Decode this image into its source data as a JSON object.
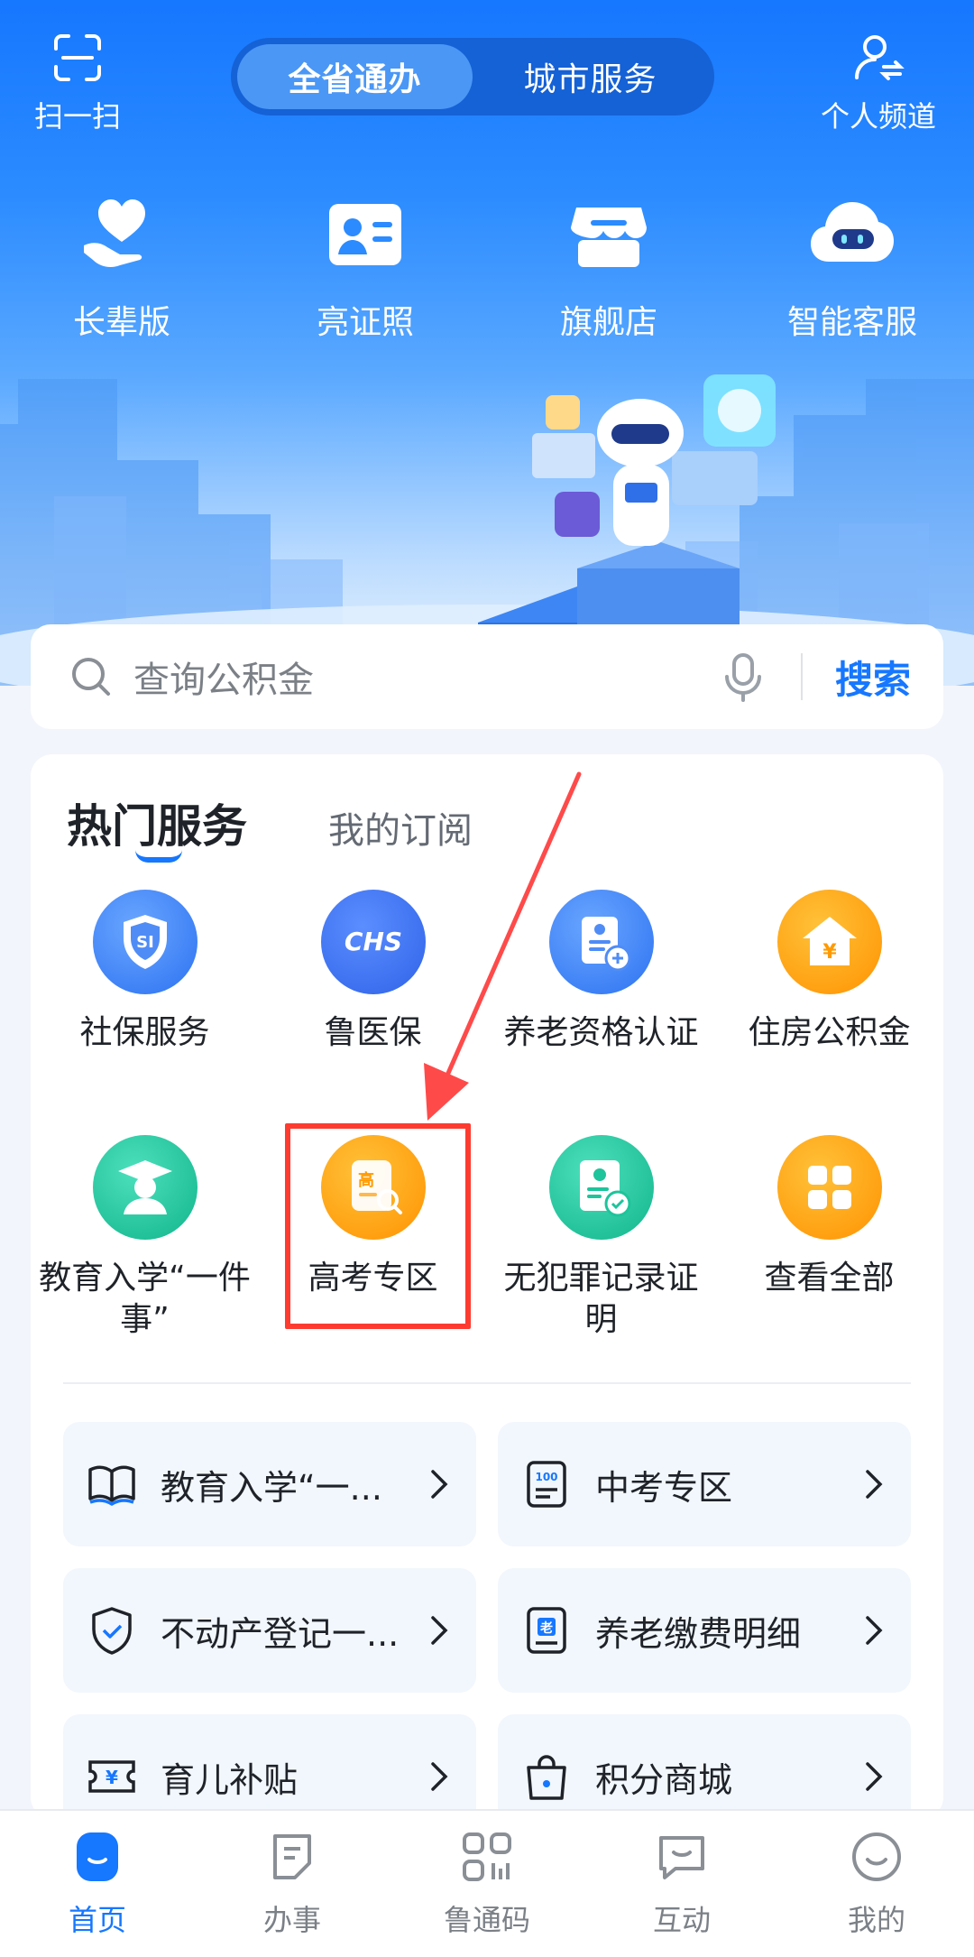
{
  "header": {
    "scan_label": "扫一扫",
    "personal_label": "个人频道",
    "tabs": [
      {
        "label": "全省通办",
        "active": true
      },
      {
        "label": "城市服务",
        "active": false
      }
    ]
  },
  "quick": [
    {
      "label": "长辈版",
      "icon": "heart-hand-icon"
    },
    {
      "label": "亮证照",
      "icon": "id-card-icon"
    },
    {
      "label": "旗舰店",
      "icon": "store-icon"
    },
    {
      "label": "智能客服",
      "icon": "robot-cloud-icon"
    }
  ],
  "search": {
    "placeholder": "查询公积金",
    "button": "搜索"
  },
  "services": {
    "tab_hot": "热门服务",
    "tab_subscribe": "我的订阅",
    "items": [
      {
        "label": "社保服务",
        "icon": "social-security-icon"
      },
      {
        "label": "鲁医保",
        "icon": "chs-icon",
        "badge": "CHS"
      },
      {
        "label": "养老资格认证",
        "icon": "pension-cert-icon"
      },
      {
        "label": "住房公积金",
        "icon": "housing-fund-icon",
        "badge": "¥"
      },
      {
        "label": "教育入学“一件事”",
        "icon": "graduate-icon"
      },
      {
        "label": "高考专区",
        "icon": "gaokao-icon",
        "badge": "高"
      },
      {
        "label": "无犯罪记录证明",
        "icon": "no-crime-cert-icon"
      },
      {
        "label": "查看全部",
        "icon": "all-apps-icon"
      }
    ]
  },
  "links": [
    {
      "label": "教育入学“一...",
      "icon": "book-icon"
    },
    {
      "label": "中考专区",
      "icon": "exam-score-icon",
      "badge": "100"
    },
    {
      "label": "不动产登记一...",
      "icon": "shield-check-icon"
    },
    {
      "label": "养老缴费明细",
      "icon": "pension-doc-icon",
      "badge": "老"
    },
    {
      "label": "育儿补贴",
      "icon": "yuan-ticket-icon",
      "badge": "¥"
    },
    {
      "label": "积分商城",
      "icon": "shopping-bag-icon"
    }
  ],
  "nav": [
    {
      "label": "首页",
      "active": true
    },
    {
      "label": "办事",
      "active": false
    },
    {
      "label": "鲁通码",
      "active": false
    },
    {
      "label": "互动",
      "active": false
    },
    {
      "label": "我的",
      "active": false
    }
  ],
  "colors": {
    "primary": "#1677ff",
    "highlight": "#ff3b30"
  }
}
